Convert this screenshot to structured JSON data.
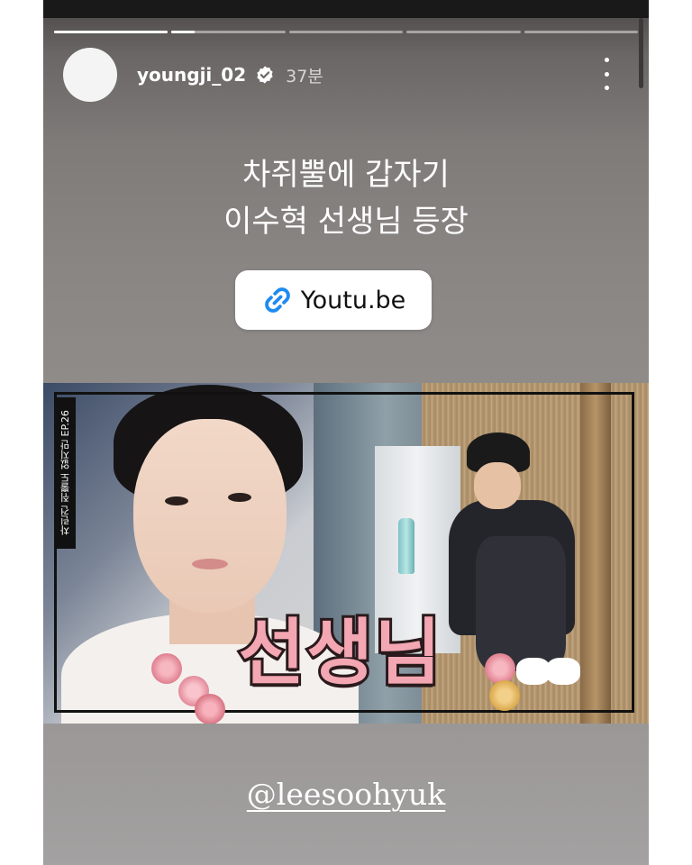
{
  "story": {
    "progress_segments": [
      1,
      0.2,
      0,
      0,
      0
    ],
    "user": {
      "username": "youngji_02",
      "verified_icon": "verified-badge-icon",
      "time_ago": "37분"
    },
    "more_icon": "more-vertical-icon",
    "caption": {
      "line1": "차쥐뿔에 갑자기",
      "line2": "이수혁 선생님 등장"
    },
    "link_sticker": {
      "icon": "link-icon",
      "label": "Youtu.be"
    },
    "thumbnail": {
      "side_text": "차린건 쥐뿔도 없지만 EP.26",
      "title": "선생님"
    },
    "mention": "@leesoohyuk"
  }
}
